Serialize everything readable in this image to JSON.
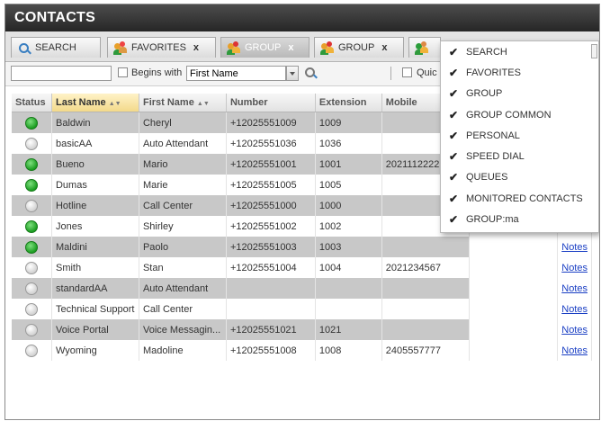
{
  "window": {
    "title": "CONTACTS"
  },
  "tabs": [
    {
      "label": "SEARCH",
      "icon": "search-icon",
      "closable": false,
      "active": false
    },
    {
      "label": "FAVORITES",
      "icon": "favorites-icon",
      "closable": true,
      "active": false
    },
    {
      "label": "GROUP",
      "icon": "group-icon",
      "closable": true,
      "active": true
    },
    {
      "label": "GROUP",
      "icon": "group-icon",
      "closable": true,
      "active": false
    }
  ],
  "tab_close_glyph": "x",
  "toolbar": {
    "search_value": "",
    "begins_with_label": "Begins with",
    "field_value": "First Name",
    "quick_label": "Quic"
  },
  "columns": [
    "Status",
    "Last Name",
    "First Name",
    "Number",
    "Extension",
    "Mobile"
  ],
  "sort_glyph": "▲▼",
  "rows": [
    {
      "status": "online",
      "last": "Baldwin",
      "first": "Cheryl",
      "number": "+12025551009",
      "ext": "1009",
      "mobile": "",
      "notes": "",
      "shade": true
    },
    {
      "status": "offline",
      "last": "basicAA",
      "first": "Auto Attendant",
      "number": "+12025551036",
      "ext": "1036",
      "mobile": "",
      "notes": "",
      "shade": false
    },
    {
      "status": "online",
      "last": "Bueno",
      "first": "Mario",
      "number": "+12025551001",
      "ext": "1001",
      "mobile": "20211122222",
      "notes": "",
      "shade": true
    },
    {
      "status": "online",
      "last": "Dumas",
      "first": "Marie",
      "number": "+12025551005",
      "ext": "1005",
      "mobile": "",
      "notes": "",
      "shade": false
    },
    {
      "status": "offline",
      "last": "Hotline",
      "first": "Call Center",
      "number": "+12025551000",
      "ext": "1000",
      "mobile": "",
      "notes": "",
      "shade": true
    },
    {
      "status": "online",
      "last": "Jones",
      "first": "Shirley",
      "number": "+12025551002",
      "ext": "1002",
      "mobile": "",
      "notes": "Notes",
      "shade": false
    },
    {
      "status": "online",
      "last": "Maldini",
      "first": "Paolo",
      "number": "+12025551003",
      "ext": "1003",
      "mobile": "",
      "notes": "Notes",
      "shade": true
    },
    {
      "status": "offline",
      "last": "Smith",
      "first": "Stan",
      "number": "+12025551004",
      "ext": "1004",
      "mobile": "2021234567",
      "notes": "Notes",
      "shade": false
    },
    {
      "status": "offline",
      "last": "standardAA",
      "first": "Auto Attendant",
      "number": "",
      "ext": "",
      "mobile": "",
      "notes": "Notes",
      "shade": true
    },
    {
      "status": "offline",
      "last": "Technical Support",
      "first": "Call Center",
      "number": "",
      "ext": "",
      "mobile": "",
      "notes": "Notes",
      "shade": false
    },
    {
      "status": "offline",
      "last": "Voice Portal",
      "first": "Voice Messagin...",
      "number": "+12025551021",
      "ext": "1021",
      "mobile": "",
      "notes": "Notes",
      "shade": true
    },
    {
      "status": "offline",
      "last": "Wyoming",
      "first": "Madoline",
      "number": "+12025551008",
      "ext": "1008",
      "mobile": "2405557777",
      "notes": "Notes",
      "shade": false
    }
  ],
  "menu": {
    "check_glyph": "✔",
    "items": [
      "SEARCH",
      "FAVORITES",
      "GROUP",
      "GROUP COMMON",
      "PERSONAL",
      "SPEED DIAL",
      "QUEUES",
      "MONITORED CONTACTS",
      "GROUP:ma"
    ]
  },
  "colors": {
    "title_bg": "#333333",
    "online": "#2aa82a",
    "offline": "#d8d8d8",
    "link": "#1a3fc4",
    "sorted_header": "#f3d98a"
  }
}
